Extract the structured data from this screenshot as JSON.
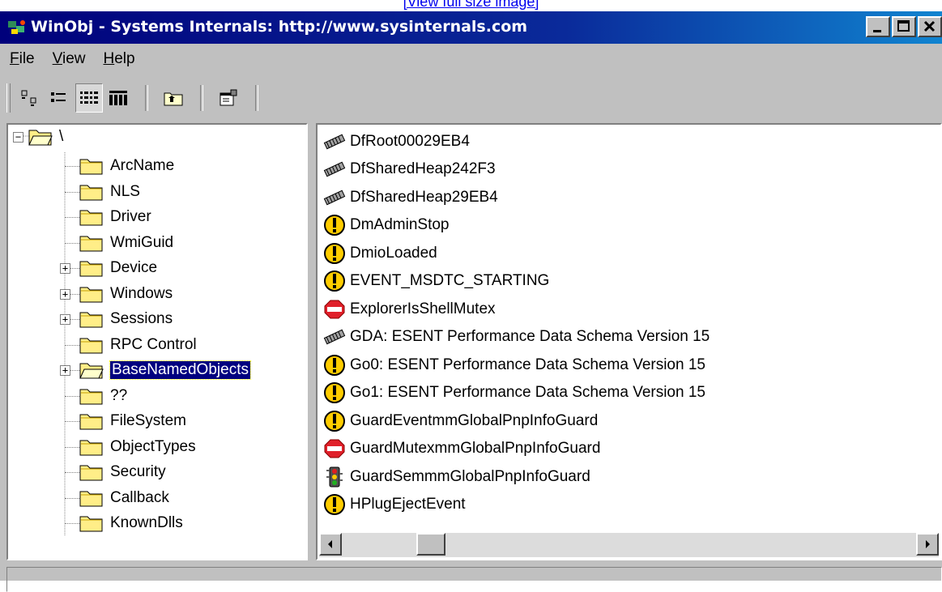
{
  "top_link": "[View full size image]",
  "window": {
    "title": "WinObj - Systems Internals: http://www.sysinternals.com"
  },
  "menu": [
    {
      "underline": "F",
      "rest": "ile"
    },
    {
      "underline": "V",
      "rest": "iew"
    },
    {
      "underline": "H",
      "rest": "elp"
    }
  ],
  "tree": {
    "root": "\\",
    "items": [
      {
        "label": "ArcName",
        "expandable": false
      },
      {
        "label": "NLS",
        "expandable": false
      },
      {
        "label": "Driver",
        "expandable": false
      },
      {
        "label": "WmiGuid",
        "expandable": false
      },
      {
        "label": "Device",
        "expandable": true
      },
      {
        "label": "Windows",
        "expandable": true
      },
      {
        "label": "Sessions",
        "expandable": true
      },
      {
        "label": "RPC Control",
        "expandable": false
      },
      {
        "label": "BaseNamedObjects",
        "expandable": true,
        "selected": true
      },
      {
        "label": "??",
        "expandable": false
      },
      {
        "label": "FileSystem",
        "expandable": false
      },
      {
        "label": "ObjectTypes",
        "expandable": false
      },
      {
        "label": "Security",
        "expandable": false
      },
      {
        "label": "Callback",
        "expandable": false
      },
      {
        "label": "KnownDlls",
        "expandable": false
      }
    ]
  },
  "objects": [
    {
      "name": "DfRoot00029EB4",
      "icon": "memory-chip-icon"
    },
    {
      "name": "DfSharedHeap242F3",
      "icon": "memory-chip-icon"
    },
    {
      "name": "DfSharedHeap29EB4",
      "icon": "memory-chip-icon"
    },
    {
      "name": "DmAdminStop",
      "icon": "event-icon"
    },
    {
      "name": "DmioLoaded",
      "icon": "event-icon"
    },
    {
      "name": "EVENT_MSDTC_STARTING",
      "icon": "event-icon"
    },
    {
      "name": "ExplorerIsShellMutex",
      "icon": "mutex-stop-icon"
    },
    {
      "name": "GDA:  ESENT Performance Data Schema Version 15",
      "icon": "memory-chip-icon"
    },
    {
      "name": "Go0:  ESENT Performance Data Schema Version 15",
      "icon": "event-icon"
    },
    {
      "name": "Go1:  ESENT Performance Data Schema Version 15",
      "icon": "event-icon"
    },
    {
      "name": "GuardEventmmGlobalPnpInfoGuard",
      "icon": "event-icon"
    },
    {
      "name": "GuardMutexmmGlobalPnpInfoGuard",
      "icon": "mutex-stop-icon"
    },
    {
      "name": "GuardSemmmGlobalPnpInfoGuard",
      "icon": "semaphore-icon"
    },
    {
      "name": "HPlugEjectEvent",
      "icon": "event-icon"
    }
  ],
  "colors": {
    "title_bar": "#00007b",
    "face": "#c0c0c0",
    "selection": "#000080",
    "event_yellow": "#ffcc00",
    "stop_red": "#e0202a"
  }
}
